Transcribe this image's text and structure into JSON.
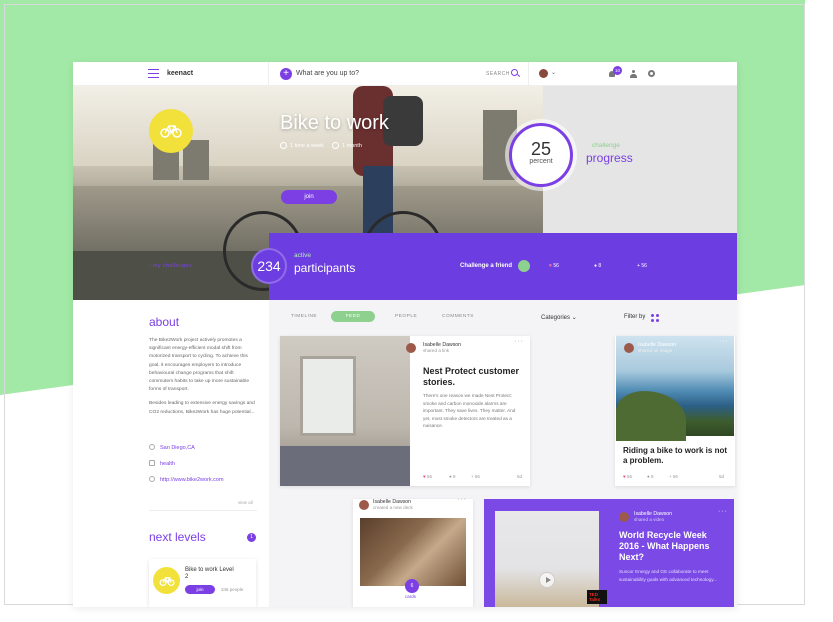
{
  "app": {
    "brand": "keenact"
  },
  "header": {
    "compose_placeholder": "What are you up to?",
    "search_label": "SEARCH",
    "notifications_count": "10"
  },
  "hero": {
    "title": "Bike to work",
    "frequency": "1 time a week",
    "duration": "1 month",
    "join_label": "join",
    "my_challenges": "my challenges"
  },
  "progress": {
    "value": "25",
    "unit": "percent",
    "label_small": "challenge",
    "label_big": "progress"
  },
  "participants": {
    "count": "234",
    "label_small": "active",
    "label_big": "participants",
    "invite": "Challenge a friend",
    "likes": "56",
    "comments": "8",
    "shares": "56"
  },
  "about": {
    "heading": "about",
    "text1": "The Bike2Work project actively promotes a significant energy-efficient modal shift from motorized transport to cycling. To achieve this goal, it encourages employers to introduce behavioural change programs that shift commuters habits to take up more sustainable forms of transport.",
    "text2": "Besides leading to extensive energy savings and CO2 reductions, Bike2Work has huge potential...",
    "location": "San Diego,CA",
    "tag": "health",
    "url": "http://www.bike2work.com",
    "view_all": "view all"
  },
  "next_levels": {
    "heading": "next levels",
    "count": "1",
    "card_title": "Bike to work Level 2",
    "join_label": "join",
    "people": "345 people"
  },
  "feed": {
    "tabs": [
      "TIMELINE",
      "FEED",
      "PEOPLE",
      "COMMENTS"
    ],
    "categories": "Categories",
    "filter": "Filter by",
    "post1": {
      "author": "Isabelle Dawson",
      "action": "shared a link",
      "title": "Nest Protect customer stories.",
      "body": "There's one reason we made Nest Protect: smoke and carbon monoxide alarms are important. They save lives. They matter. And yet, most smoke detectors are treated as a nuisance.",
      "likes": "56",
      "comments": "8",
      "shares": "56",
      "time": "5d"
    },
    "post2": {
      "author": "Isabelle Dawson",
      "action": "shared an image",
      "title": "Riding a bike to work is not a problem.",
      "likes": "56",
      "comments": "8",
      "shares": "56",
      "time": "5d"
    },
    "post3": {
      "author": "Isabelle Dawson",
      "action": "created a new deck",
      "cards_count": "6",
      "cards_label": "cards"
    },
    "post4": {
      "author": "Isabelle Dawson",
      "action": "shared a video",
      "title": "World Recycle Week 2016 - What Happens Next?",
      "body": "Suncor Energy and GE collaborate to meet sustainability goals with advanced technology...",
      "ted": "TED Talks"
    }
  },
  "colors": {
    "accent": "#7b3fe4",
    "green": "#8ed08e",
    "yellow": "#f2e13b",
    "bg_green": "#a2e8a6"
  }
}
